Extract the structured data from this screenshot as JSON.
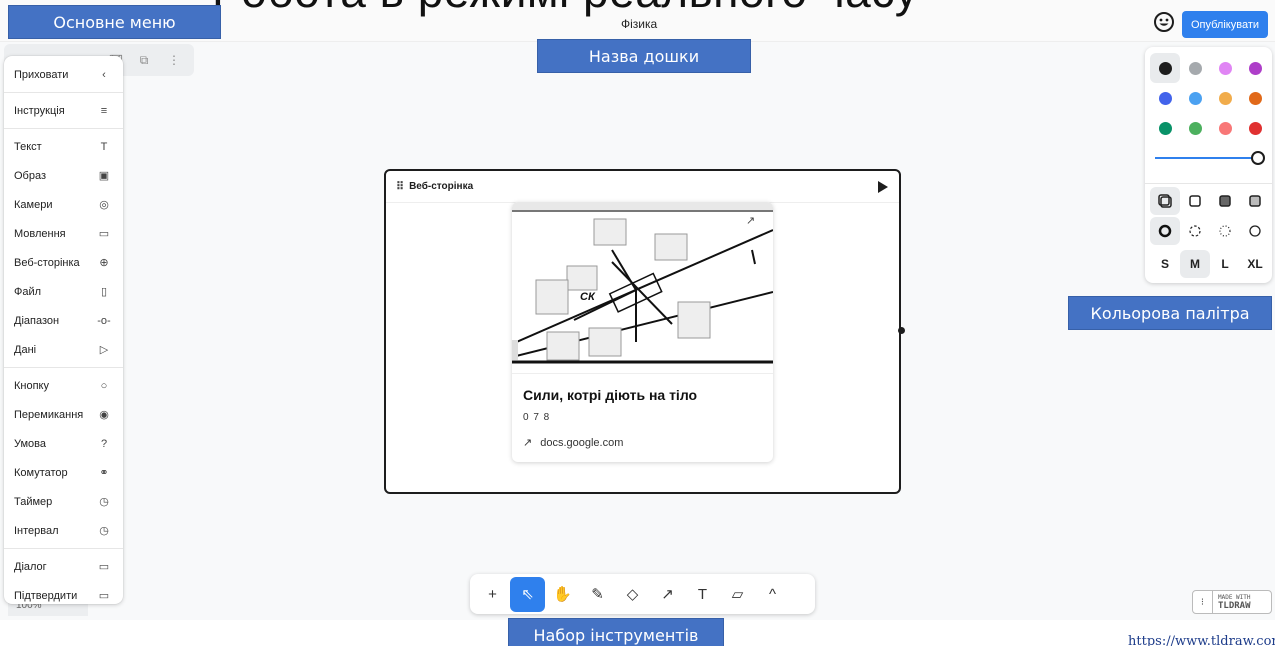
{
  "slide_heading": "Робота в режимі реального часу",
  "callouts": {
    "menu": "Основне меню",
    "board": "Назва дошки",
    "palette": "Кольорова палітра",
    "tools": "Набор інструментів"
  },
  "header": {
    "board_name": "Фізика",
    "emoji_icon": "smile-icon",
    "publish_label": "Опублікувати"
  },
  "menu": {
    "items": [
      {
        "label": "Приховати",
        "icon": "chevron-left-icon",
        "glyph": "‹"
      },
      {
        "label": "Інструкція",
        "icon": "list-icon",
        "glyph": "≡"
      },
      {
        "label": "Текст",
        "icon": "text-icon",
        "glyph": "T"
      },
      {
        "label": "Образ",
        "icon": "image-icon",
        "glyph": "▣"
      },
      {
        "label": "Камери",
        "icon": "camera-icon",
        "glyph": "◎"
      },
      {
        "label": "Мовлення",
        "icon": "speech-icon",
        "glyph": "▭"
      },
      {
        "label": "Веб-сторінка",
        "icon": "globe-icon",
        "glyph": "⊕"
      },
      {
        "label": "Файл",
        "icon": "file-icon",
        "glyph": "▯"
      },
      {
        "label": "Діапазон",
        "icon": "range-icon",
        "glyph": "-o-"
      },
      {
        "label": "Дані",
        "icon": "send-icon",
        "glyph": "▷"
      },
      {
        "label": "Кнопку",
        "icon": "circle-icon",
        "glyph": "○"
      },
      {
        "label": "Перемикання",
        "icon": "toggle-icon",
        "glyph": "◉"
      },
      {
        "label": "Умова",
        "icon": "question-icon",
        "glyph": "?"
      },
      {
        "label": "Комутатор",
        "icon": "switch-icon",
        "glyph": "⚭"
      },
      {
        "label": "Таймер",
        "icon": "clock-icon",
        "glyph": "◷"
      },
      {
        "label": "Інтервал",
        "icon": "clock-icon",
        "glyph": "◷"
      },
      {
        "label": "Діалог",
        "icon": "dialog-icon",
        "glyph": "▭"
      },
      {
        "label": "Підтвердити",
        "icon": "dialog-icon",
        "glyph": "▭"
      }
    ],
    "zoom": "100%"
  },
  "frame": {
    "title": "Веб-сторінка",
    "play_icon": "play-icon"
  },
  "card": {
    "title": "Сили, котрі діють на тіло",
    "subtitle": "0 7 8",
    "link": "docs.google.com",
    "image_label": "СК"
  },
  "palette": {
    "colors": [
      "#1d1d1d",
      "#a5a9ad",
      "#e085f4",
      "#ae3ec9",
      "#4263eb",
      "#4ba1f1",
      "#f1ac4b",
      "#e16919",
      "#099268",
      "#4cb05e",
      "#f87777",
      "#e03131"
    ],
    "selected_color": "#1d1d1d",
    "sizes": [
      "S",
      "M",
      "L",
      "XL"
    ],
    "selected_size": "M"
  },
  "toolbar": {
    "tools": [
      {
        "name": "add-tool",
        "glyph": "+"
      },
      {
        "name": "select-tool",
        "glyph": "⇖"
      },
      {
        "name": "hand-tool",
        "glyph": "✋"
      },
      {
        "name": "draw-tool",
        "glyph": "✎"
      },
      {
        "name": "eraser-tool",
        "glyph": "◇"
      },
      {
        "name": "arrow-tool",
        "glyph": "↗"
      },
      {
        "name": "text-tool",
        "glyph": "T"
      },
      {
        "name": "note-tool",
        "glyph": "▱"
      },
      {
        "name": "more-tool",
        "glyph": "^"
      }
    ],
    "active": "select-tool"
  },
  "branding": {
    "made_with": "MADE WITH",
    "name": "TLDRAW",
    "url": "https://www.tldraw.com/"
  }
}
